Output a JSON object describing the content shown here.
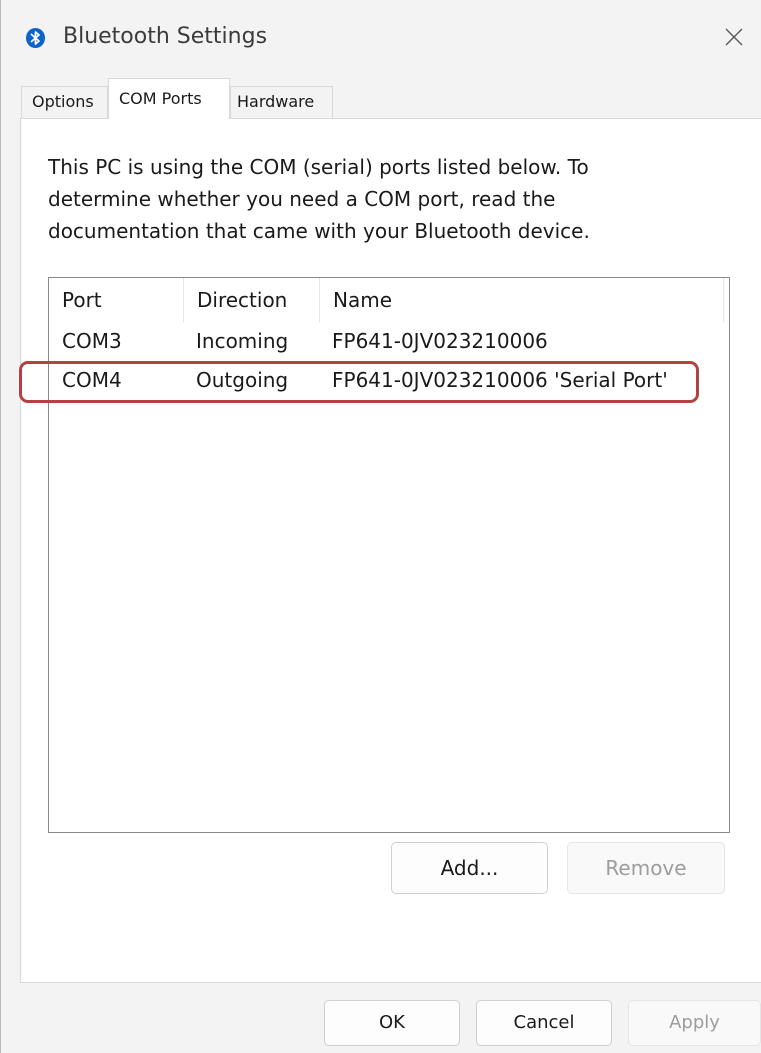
{
  "window": {
    "title": "Bluetooth Settings",
    "icon": "bluetooth-icon",
    "close_icon": "close-icon"
  },
  "tabs": [
    {
      "label": "Options",
      "active": false
    },
    {
      "label": "COM Ports",
      "active": true
    },
    {
      "label": "Hardware",
      "active": false
    }
  ],
  "com_ports": {
    "description": "This PC is using the COM (serial) ports listed below. To determine whether you need a COM port, read the documentation that came with your Bluetooth device.",
    "columns": [
      "Port",
      "Direction",
      "Name"
    ],
    "rows": [
      {
        "port": "COM3",
        "direction": "Incoming",
        "name": "FP641-0JV023210006"
      },
      {
        "port": "COM4",
        "direction": "Outgoing",
        "name": "FP641-0JV023210006 'Serial Port'"
      }
    ],
    "highlighted_row": "COM4",
    "highlight_color": "#b34343",
    "add_label": "Add...",
    "remove_label": "Remove"
  },
  "footer": {
    "ok_label": "OK",
    "cancel_label": "Cancel",
    "apply_label": "Apply"
  },
  "colors": {
    "bluetooth_blue": "#0b63c9",
    "window_bg": "#f3f3f3",
    "disabled_text": "#9d9d9d"
  }
}
